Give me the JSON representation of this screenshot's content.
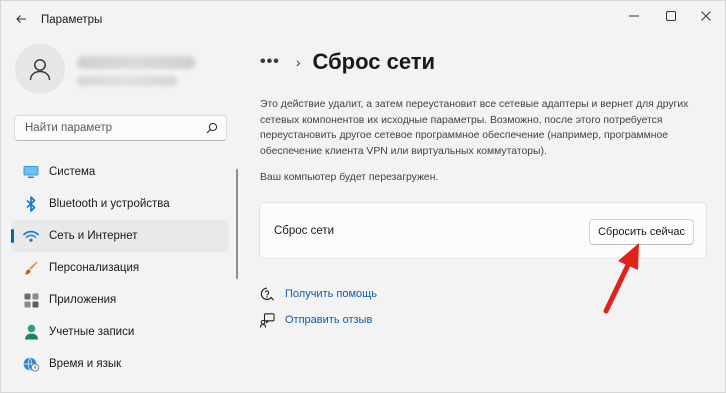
{
  "window": {
    "title": "Параметры",
    "back_icon": "arrow-left-icon",
    "controls": [
      "minimize-icon",
      "maximize-icon",
      "close-icon"
    ]
  },
  "search": {
    "placeholder": "Найти параметр",
    "icon": "search-icon"
  },
  "sidebar": {
    "items": [
      {
        "label": "Система",
        "icon": "monitor-icon",
        "active": false
      },
      {
        "label": "Bluetooth и устройства",
        "icon": "bluetooth-icon",
        "active": false
      },
      {
        "label": "Сеть и Интернет",
        "icon": "wifi-icon",
        "active": true
      },
      {
        "label": "Персонализация",
        "icon": "brush-icon",
        "active": false
      },
      {
        "label": "Приложения",
        "icon": "apps-icon",
        "active": false
      },
      {
        "label": "Учетные записи",
        "icon": "person-icon",
        "active": false
      },
      {
        "label": "Время и язык",
        "icon": "globe-clock-icon",
        "active": false
      }
    ]
  },
  "breadcrumb": {
    "more": "•••",
    "separator": "›",
    "title": "Сброс сети"
  },
  "main": {
    "description": "Это действие удалит, а затем переустановит все сетевые адаптеры и вернет для других сетевых компонентов их исходные параметры. Возможно, после этого потребуется переустановить другое сетевое программное обеспечение (например, программное обеспечение клиента VPN или виртуальных коммутаторы).",
    "restart_note": "Ваш компьютер будет перезагружен.",
    "card_label": "Сброс сети",
    "reset_button": "Сбросить сейчас",
    "links": [
      {
        "label": "Получить помощь",
        "icon": "help-icon"
      },
      {
        "label": "Отправить отзыв",
        "icon": "feedback-icon"
      }
    ]
  },
  "colors": {
    "accent": "#0067c0",
    "link": "#0a5db0",
    "annotation_arrow": "#e0221b"
  }
}
